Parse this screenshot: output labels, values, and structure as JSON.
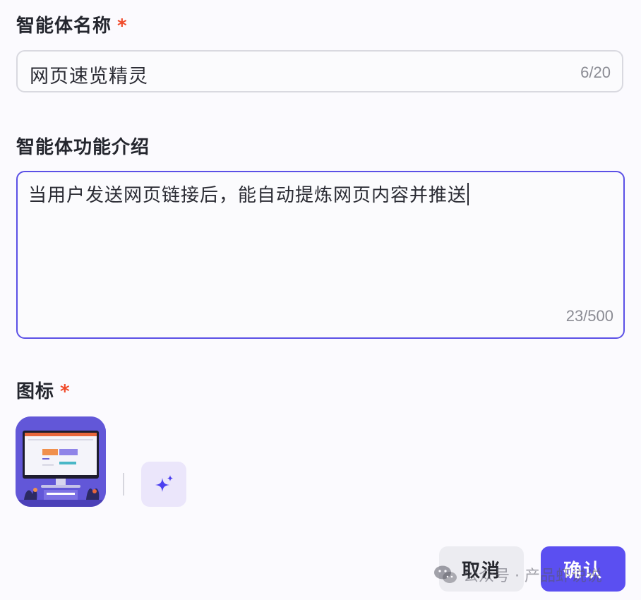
{
  "agent_name": {
    "label": "智能体名称",
    "required_mark": "*",
    "value": "网页速览精灵",
    "counter": "6/20"
  },
  "agent_description": {
    "label": "智能体功能介绍",
    "value": "当用户发送网页链接后，能自动提炼网页内容并推送",
    "counter": "23/500"
  },
  "icon_section": {
    "label": "图标",
    "required_mark": "*",
    "ai_generate_icon": "sparkle-icon"
  },
  "actions": {
    "cancel_label": "取消",
    "confirm_label": "确认"
  },
  "watermark": {
    "text": "公众号 · 产品虾说说",
    "icon": "wechat-icon"
  },
  "colors": {
    "accent": "#5b4ff1",
    "focus_border": "#5b50e6",
    "required": "#f04a2a",
    "icon_tile_bg": "#6257d8"
  }
}
